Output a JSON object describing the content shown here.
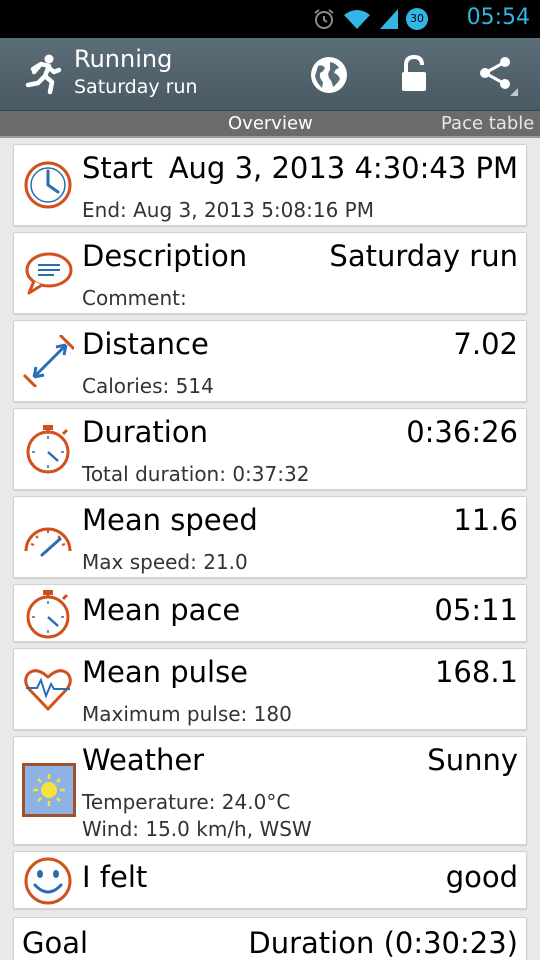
{
  "status_bar": {
    "time": "05:54",
    "notification_badge": "30"
  },
  "app_bar": {
    "title": "Running",
    "subtitle": "Saturday run"
  },
  "tabs": [
    {
      "label": "Overview"
    },
    {
      "label": "Pace table"
    }
  ],
  "rows": {
    "start": {
      "label": "Start",
      "value": "Aug 3, 2013 4:30:43 PM",
      "sub": "End: Aug 3, 2013 5:08:16 PM",
      "icon": "clock-icon"
    },
    "description": {
      "label": "Description",
      "value": "Saturday run",
      "sub": "Comment:",
      "icon": "comment-icon"
    },
    "distance": {
      "label": "Distance",
      "value": "7.02",
      "sub": "Calories: 514",
      "icon": "distance-icon"
    },
    "duration": {
      "label": "Duration",
      "value": "0:36:26",
      "sub": "Total duration: 0:37:32",
      "icon": "stopwatch-icon"
    },
    "mean_speed": {
      "label": "Mean speed",
      "value": "11.6",
      "sub": "Max speed: 21.0",
      "icon": "speedometer-icon"
    },
    "mean_pace": {
      "label": "Mean pace",
      "value": "05:11",
      "icon": "stopwatch-icon"
    },
    "mean_pulse": {
      "label": "Mean pulse",
      "value": "168.1",
      "sub": "Maximum pulse: 180",
      "icon": "heart-pulse-icon"
    },
    "weather": {
      "label": "Weather",
      "value": "Sunny",
      "sub1": "Temperature: 24.0°C",
      "sub2": "Wind: 15.0 km/h, WSW",
      "icon": "sun-icon"
    },
    "felt": {
      "label": "I felt",
      "value": "good",
      "icon": "smiley-icon"
    },
    "goal": {
      "label": "Goal",
      "value": "Duration (0:30:23)"
    }
  },
  "colors": {
    "accent": "#33b5e5",
    "icon_orange": "#d2501e",
    "icon_blue": "#2a6db5",
    "action_bar": "#4f606b"
  }
}
